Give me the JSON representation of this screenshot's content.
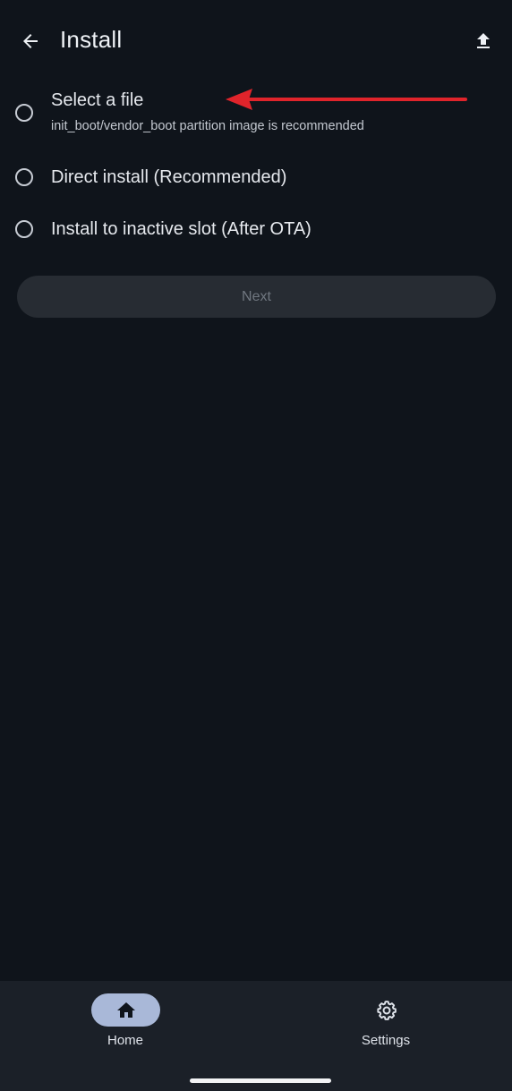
{
  "header": {
    "title": "Install",
    "back_icon": "back-arrow-icon",
    "upload_icon": "upload-icon"
  },
  "options": [
    {
      "label": "Select a file",
      "sublabel": "init_boot/vendor_boot partition image is recommended",
      "selected": false
    },
    {
      "label": "Direct install (Recommended)",
      "selected": false
    },
    {
      "label": "Install to inactive slot (After OTA)",
      "selected": false
    }
  ],
  "actions": {
    "next_label": "Next",
    "next_enabled": false
  },
  "annotation": {
    "arrow_color": "#e0242b"
  },
  "bottom_nav": {
    "items": [
      {
        "label": "Home",
        "icon": "home-icon",
        "active": true
      },
      {
        "label": "Settings",
        "icon": "gear-icon",
        "active": false
      }
    ]
  },
  "colors": {
    "background": "#0f141b",
    "nav_background": "#1b2028",
    "active_pill": "#a9b8d8"
  }
}
